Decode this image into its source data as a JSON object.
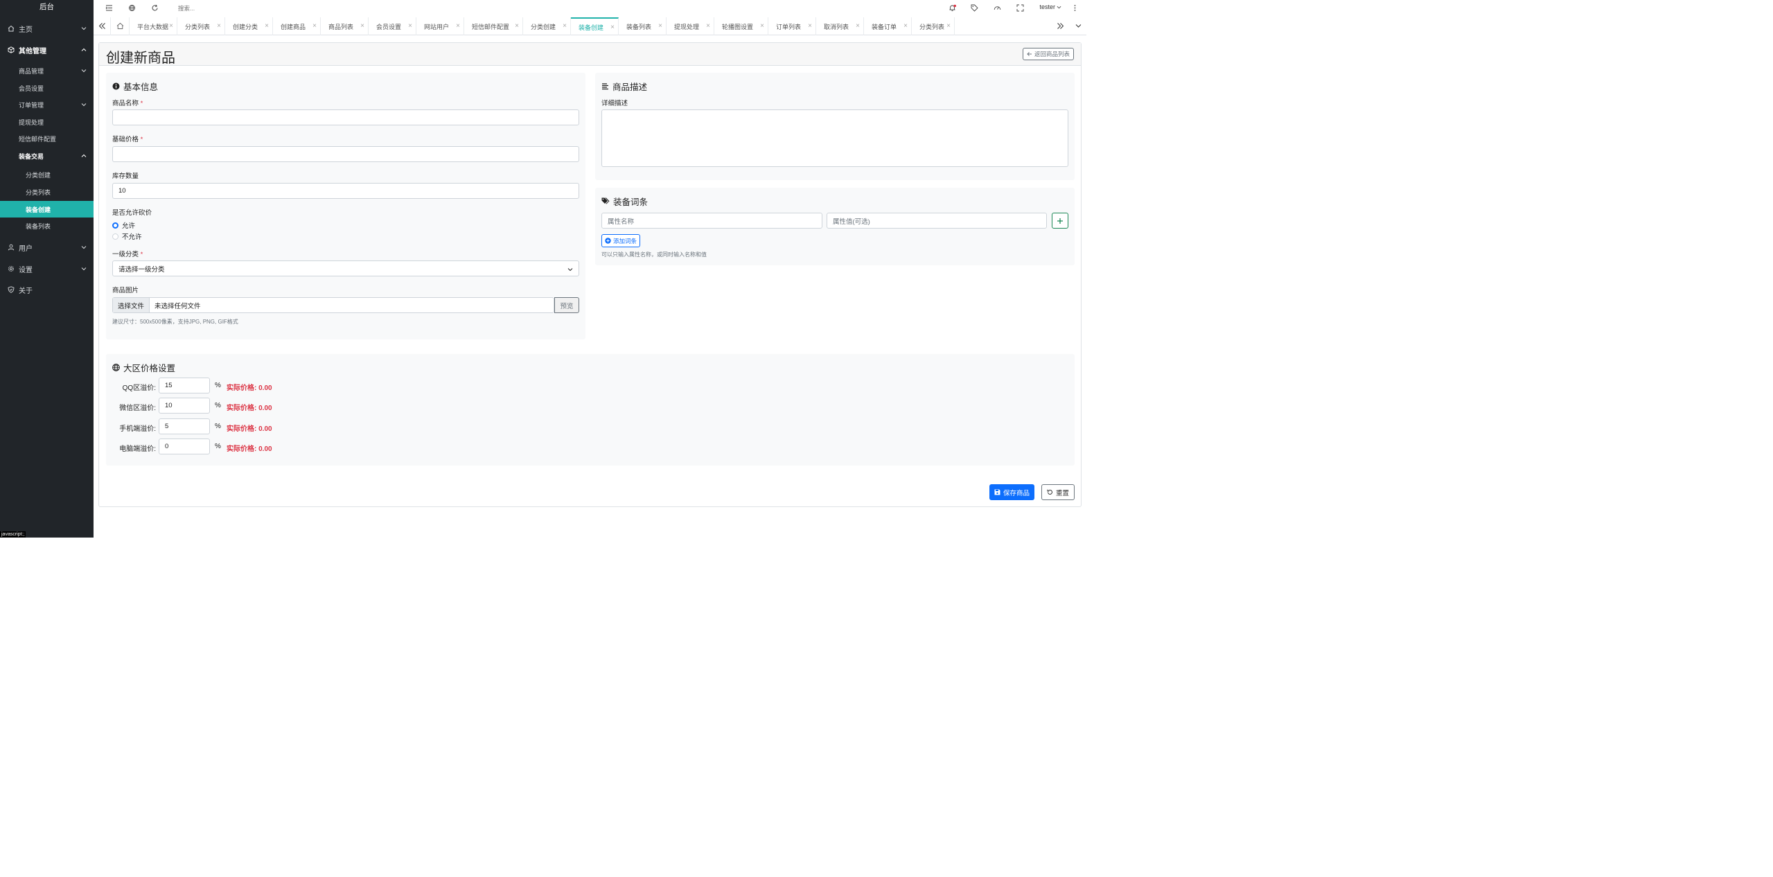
{
  "sidebar": {
    "brand": "后台",
    "items": [
      {
        "label": "主页"
      },
      {
        "label": "其他管理"
      },
      {
        "label": "商品管理"
      },
      {
        "label": "会员设置"
      },
      {
        "label": "订单管理"
      },
      {
        "label": "提现处理"
      },
      {
        "label": "短信邮件配置"
      },
      {
        "label": "装备交易"
      },
      {
        "label": "分类创建"
      },
      {
        "label": "分类列表"
      },
      {
        "label": "装备创建"
      },
      {
        "label": "装备列表"
      },
      {
        "label": "用户"
      },
      {
        "label": "设置"
      },
      {
        "label": "关于"
      }
    ],
    "status_url": "javascript:;"
  },
  "topbar": {
    "search_placeholder": "搜索...",
    "user": "tester"
  },
  "tabs": [
    "平台大数据",
    "分类列表",
    "创建分类",
    "创建商品",
    "商品列表",
    "会员设置",
    "网站用户",
    "短信邮件配置",
    "分类创建",
    "装备创建",
    "装备列表",
    "提现处理",
    "轮播图设置",
    "订单列表",
    "取消列表",
    "装备订单",
    "分类列表"
  ],
  "page": {
    "title": "创建新商品",
    "back_label": "返回商品列表"
  },
  "basic": {
    "title": "基本信息",
    "name_label": "商品名称",
    "name_value": "",
    "price_label": "基础价格",
    "price_value": "",
    "stock_label": "库存数量",
    "stock_value": "10",
    "bargain_label": "是否允许砍价",
    "allow": "允许",
    "disallow": "不允许",
    "category_label": "一级分类",
    "category_value": "请选择一级分类",
    "image_label": "商品图片",
    "choose_file": "选择文件",
    "no_file": "未选择任何文件",
    "preview": "预览",
    "image_hint": "建议尺寸：500x500像素，支持JPG, PNG, GIF格式",
    "required_mark": "*"
  },
  "desc": {
    "title": "商品描述",
    "label": "详细描述",
    "value": ""
  },
  "attrs": {
    "title": "装备词条",
    "name_placeholder": "属性名称",
    "value_placeholder": "属性值(可选)",
    "add_label": "添加词条",
    "hint": "可以只输入属性名称，或同时输入名称和值"
  },
  "regions": {
    "title": "大区价格设置",
    "pct_sign": "%",
    "rows": [
      {
        "label": "QQ区溢价:",
        "value": "15",
        "real": "实际价格: 0.00"
      },
      {
        "label": "微信区溢价:",
        "value": "10",
        "real": "实际价格: 0.00"
      },
      {
        "label": "手机端溢价:",
        "value": "5",
        "real": "实际价格: 0.00"
      },
      {
        "label": "电脑端溢价:",
        "value": "0",
        "real": "实际价格: 0.00"
      }
    ]
  },
  "footer": {
    "save": "保存商品",
    "reset": "重置"
  },
  "colors": {
    "sidebar_bg": "#212529",
    "accent": "#20b2aa",
    "primary": "#0d6efd",
    "danger": "#dc3545"
  }
}
